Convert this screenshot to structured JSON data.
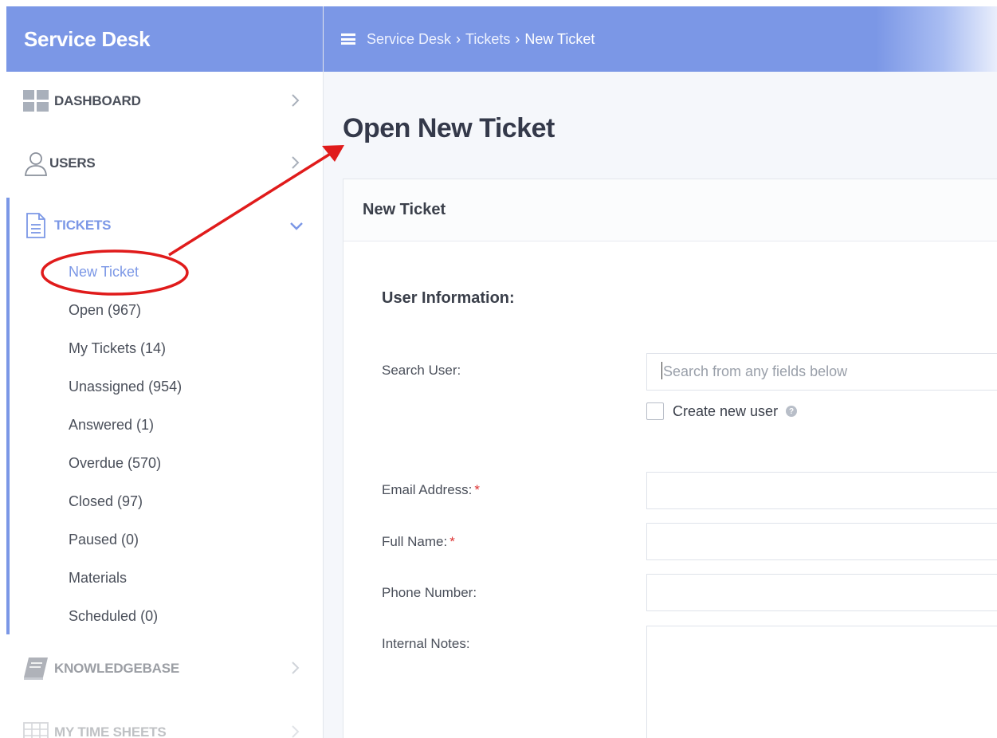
{
  "sidebar": {
    "brand": "Service Desk",
    "items": [
      {
        "label": "DASHBOARD",
        "icon": "grid-icon"
      },
      {
        "label": "USERS",
        "icon": "user-icon"
      },
      {
        "label": "TICKETS",
        "icon": "ticket-document-icon"
      },
      {
        "label": "KNOWLEDGEBASE",
        "icon": "book-icon"
      },
      {
        "label": "MY TIME SHEETS",
        "icon": "table-icon"
      }
    ],
    "tickets_submenu": [
      "New Ticket",
      "Open (967)",
      "My Tickets (14)",
      "Unassigned (954)",
      "Answered (1)",
      "Overdue (570)",
      "Closed (97)",
      "Paused (0)",
      "Materials",
      "Scheduled (0)"
    ]
  },
  "header": {
    "breadcrumb": [
      "Service Desk",
      "Tickets",
      "New Ticket"
    ]
  },
  "main": {
    "page_title": "Open New Ticket",
    "card_title": "New Ticket",
    "section_title": "User Information:",
    "search_label": "Search User:",
    "search_placeholder": "Search from any fields below",
    "create_user_label": "Create new user",
    "email_label": "Email Address:",
    "fullname_label": "Full Name:",
    "phone_label": "Phone Number:",
    "notes_label": "Internal Notes:",
    "required_mark": "*"
  },
  "colors": {
    "accent": "#7b97e6",
    "annotation": "#e01b1b"
  }
}
